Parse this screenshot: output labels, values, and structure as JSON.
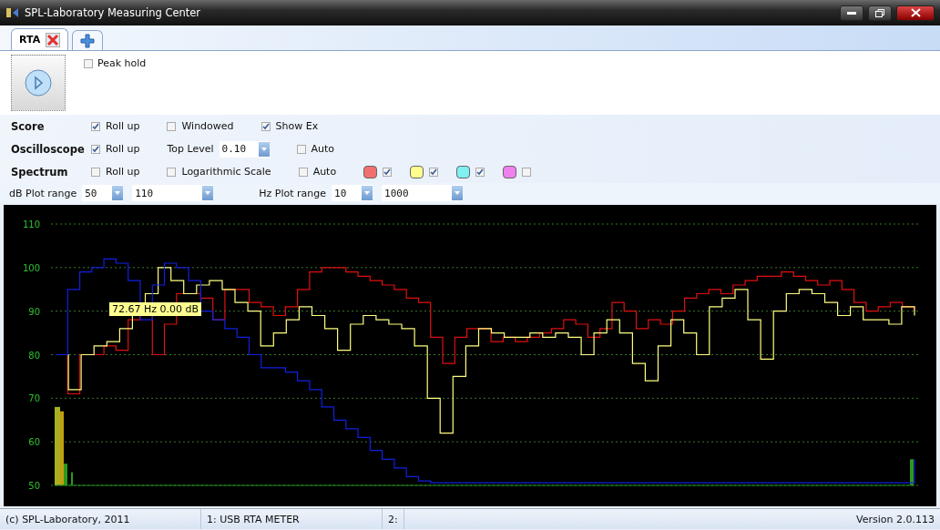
{
  "window": {
    "title": "SPL-Laboratory Measuring Center"
  },
  "tabs": [
    {
      "label": "RTA",
      "kind": "document",
      "selected": true
    },
    {
      "kind": "add",
      "selected": false
    }
  ],
  "top_panel": {
    "peak_hold": {
      "label": "Peak hold",
      "checked": false
    }
  },
  "rows": [
    {
      "title": "Score",
      "items": [
        {
          "kind": "check",
          "label": "Roll up",
          "checked": true
        },
        {
          "kind": "check",
          "label": "Windowed",
          "checked": false
        },
        {
          "kind": "check",
          "label": "Show Ex",
          "checked": true
        }
      ]
    },
    {
      "title": "Oscilloscope",
      "items": [
        {
          "kind": "check",
          "label": "Roll up",
          "checked": true
        },
        {
          "kind": "dropdown",
          "label": "Top Level",
          "value": "0.10"
        },
        {
          "kind": "check",
          "label": "Auto",
          "checked": false
        }
      ]
    },
    {
      "title": "Spectrum",
      "items": [
        {
          "kind": "check",
          "label": "Roll up",
          "checked": false
        },
        {
          "kind": "check",
          "label": "Logarithmic Scale",
          "checked": false
        },
        {
          "kind": "check",
          "label": "Auto",
          "checked": false
        },
        {
          "kind": "swatch",
          "color": "#f07070",
          "checked": true
        },
        {
          "kind": "swatch",
          "color": "#ffff90",
          "checked": true
        },
        {
          "kind": "swatch",
          "color": "#80f0f0",
          "checked": true
        },
        {
          "kind": "swatch",
          "color": "#f080f0",
          "checked": false
        }
      ]
    }
  ],
  "ranges": [
    {
      "label": "dB Plot range",
      "from": "50",
      "to": "110"
    },
    {
      "label": "Hz Plot range",
      "from": "10",
      "to": "1000"
    }
  ],
  "spectrum": {
    "cursor_label": "72.67 Hz 0.00 dB",
    "y_axis_labels": [
      "110",
      "100",
      "90",
      "80",
      "70",
      "60",
      "50"
    ]
  },
  "status_bar": [
    "(c) SPL-Laboratory, 2011",
    "1: USB RTA METER",
    "2:",
    "Version 2.0.113"
  ]
}
